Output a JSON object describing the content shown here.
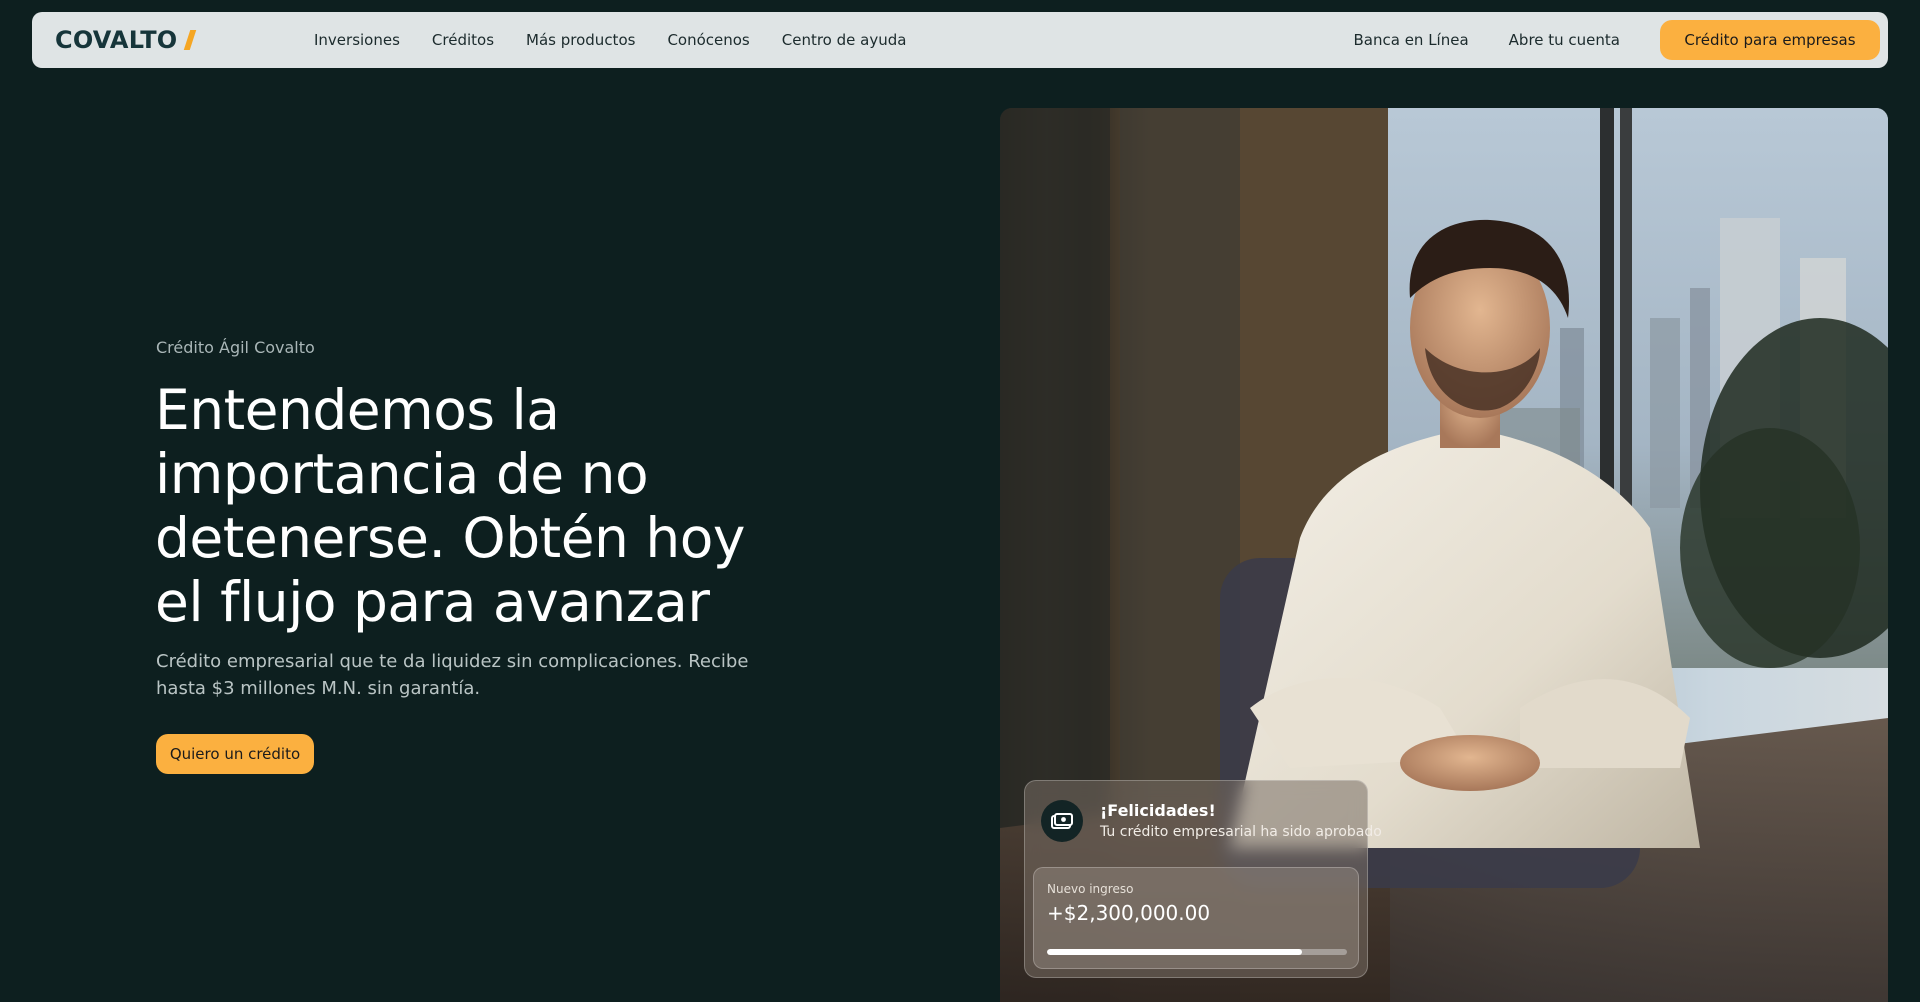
{
  "brand": {
    "name": "COVALTO",
    "accent_color": "#fbb040",
    "background_color": "#0d1f1f"
  },
  "nav": {
    "links": [
      "Inversiones",
      "Créditos",
      "Más productos",
      "Conócenos",
      "Centro de ayuda"
    ],
    "right_links": [
      "Banca en Línea",
      "Abre tu cuenta"
    ],
    "cta": "Crédito para empresas"
  },
  "hero": {
    "eyebrow": "Crédito Ágil Covalto",
    "headline": "Entendemos la importancia de no detenerse. Obtén hoy el flujo para avanzar",
    "subtext": "Crédito empresarial que te da liquidez sin complicaciones. Recibe hasta $3 millones M.N. sin garantía.",
    "cta": "Quiero un crédito"
  },
  "notification": {
    "icon": "cash-icon",
    "title": "¡Felicidades!",
    "subtitle": "Tu crédito empresarial ha sido aprobado",
    "label": "Nuevo ingreso",
    "amount": "+$2,300,000.00",
    "progress": 0.85
  }
}
